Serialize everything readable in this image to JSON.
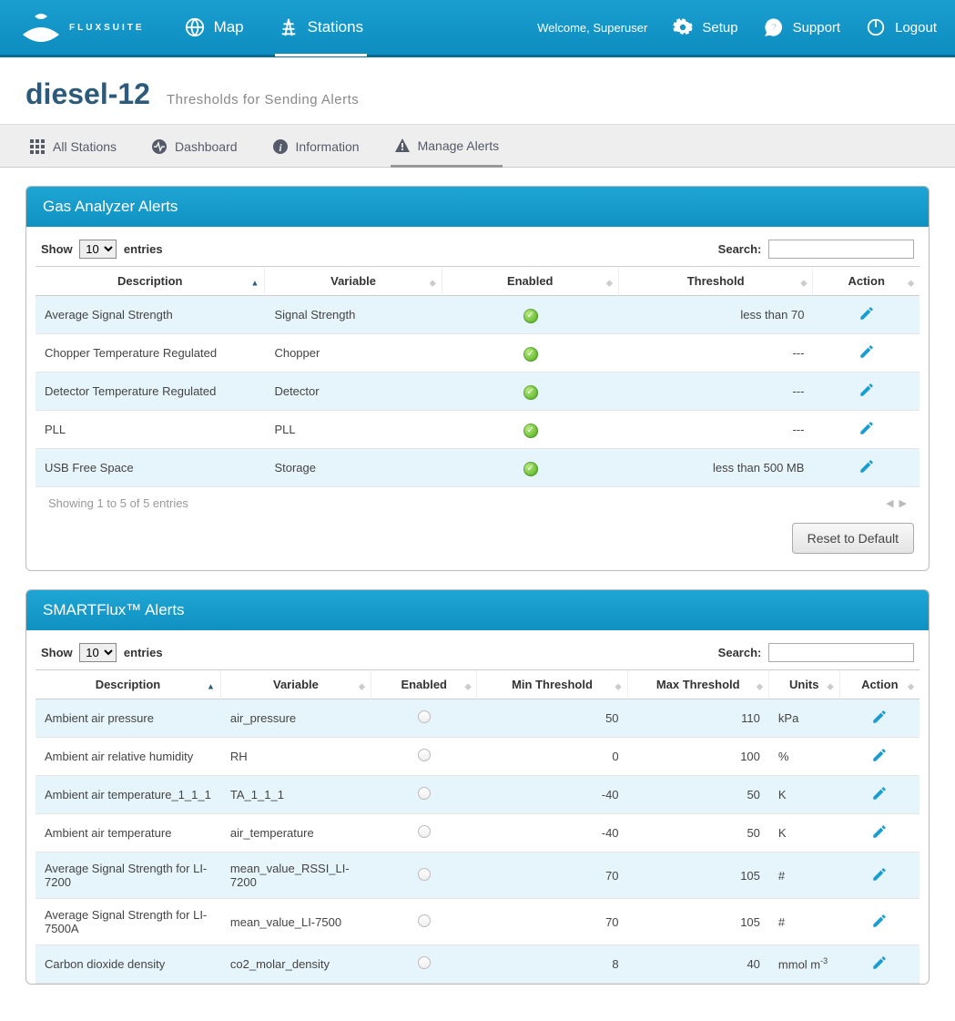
{
  "topbar": {
    "brand": "FLUXSUITE",
    "nav": [
      {
        "label": "Map"
      },
      {
        "label": "Stations",
        "active": true
      }
    ],
    "welcome": "Welcome, Superuser",
    "right": [
      {
        "label": "Setup"
      },
      {
        "label": "Support"
      },
      {
        "label": "Logout"
      }
    ]
  },
  "page": {
    "title": "diesel-12",
    "subtitle": "Thresholds for Sending Alerts"
  },
  "subnav": [
    {
      "label": "All Stations"
    },
    {
      "label": "Dashboard"
    },
    {
      "label": "Information"
    },
    {
      "label": "Manage Alerts",
      "active": true
    }
  ],
  "gas": {
    "title": "Gas Analyzer Alerts",
    "show_prefix": "Show",
    "show_value": "10",
    "show_suffix": "entries",
    "search_label": "Search:",
    "columns": [
      "Description",
      "Variable",
      "Enabled",
      "Threshold",
      "Action"
    ],
    "rows": [
      {
        "description": "Average Signal Strength",
        "variable": "Signal Strength",
        "enabled": true,
        "threshold": "less than 70"
      },
      {
        "description": "Chopper Temperature Regulated",
        "variable": "Chopper",
        "enabled": true,
        "threshold": "---"
      },
      {
        "description": "Detector Temperature Regulated",
        "variable": "Detector",
        "enabled": true,
        "threshold": "---"
      },
      {
        "description": "PLL",
        "variable": "PLL",
        "enabled": true,
        "threshold": "---"
      },
      {
        "description": "USB Free Space",
        "variable": "Storage",
        "enabled": true,
        "threshold": "less than 500 MB"
      }
    ],
    "footer_info": "Showing 1 to 5 of 5 entries",
    "reset_label": "Reset to Default"
  },
  "smart": {
    "title": "SMARTFlux™ Alerts",
    "show_prefix": "Show",
    "show_value": "10",
    "show_suffix": "entries",
    "search_label": "Search:",
    "columns": [
      "Description",
      "Variable",
      "Enabled",
      "Min Threshold",
      "Max Threshold",
      "Units",
      "Action"
    ],
    "rows": [
      {
        "description": "Ambient air pressure",
        "variable": "air_pressure",
        "enabled": false,
        "min": "50",
        "max": "110",
        "units": "kPa"
      },
      {
        "description": "Ambient air relative humidity",
        "variable": "RH",
        "enabled": false,
        "min": "0",
        "max": "100",
        "units": "%"
      },
      {
        "description": "Ambient air temperature_1_1_1",
        "variable": "TA_1_1_1",
        "enabled": false,
        "min": "-40",
        "max": "50",
        "units": "K"
      },
      {
        "description": "Ambient air temperature",
        "variable": "air_temperature",
        "enabled": false,
        "min": "-40",
        "max": "50",
        "units": "K"
      },
      {
        "description": "Average Signal Strength for LI-7200",
        "variable": "mean_value_RSSI_LI-7200",
        "enabled": false,
        "min": "70",
        "max": "105",
        "units": "#"
      },
      {
        "description": "Average Signal Strength for LI-7500A",
        "variable": "mean_value_LI-7500",
        "enabled": false,
        "min": "70",
        "max": "105",
        "units": "#"
      },
      {
        "description": "Carbon dioxide density",
        "variable": "co2_molar_density",
        "enabled": false,
        "min": "8",
        "max": "40",
        "units": "mmol m-3"
      }
    ]
  }
}
